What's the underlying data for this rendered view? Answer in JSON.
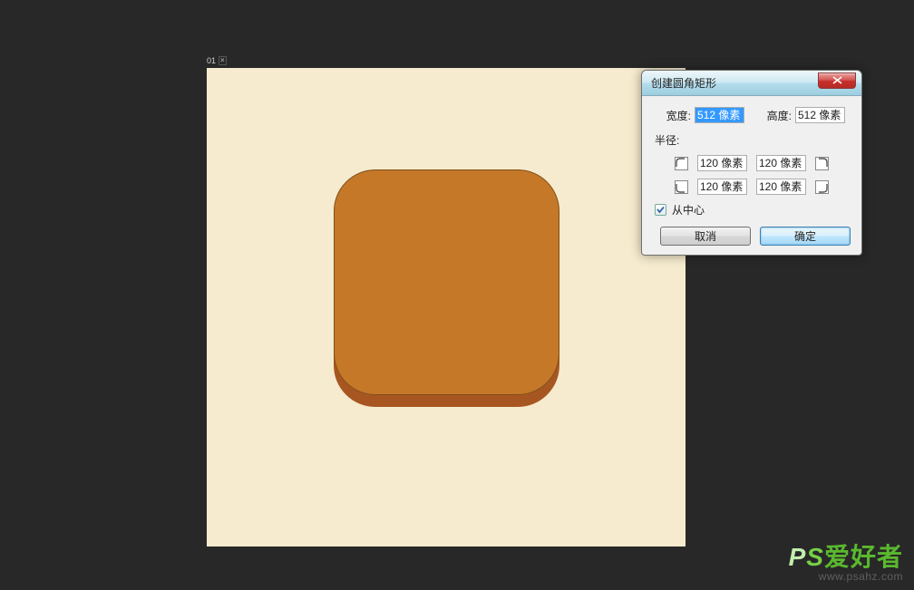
{
  "canvas": {
    "tab_label": "01"
  },
  "dialog": {
    "title": "创建圆角矩形",
    "width_label": "宽度:",
    "width_value": "512 像素",
    "height_label": "高度:",
    "height_value": "512 像素",
    "radius_label": "半径:",
    "r_tl": "120 像素",
    "r_tr": "120 像素",
    "r_bl": "120 像素",
    "r_br": "120 像素",
    "from_center_label": "从中心",
    "from_center_checked": true,
    "cancel": "取消",
    "ok": "确定"
  },
  "watermark": {
    "p": "P",
    "s": "S",
    "cn": "爱好者",
    "url": "www.psahz.com"
  },
  "colors": {
    "canvas_bg": "#f6ebce",
    "shape_front": "#c47828",
    "shape_back": "#a85621",
    "workspace": "#282828"
  }
}
